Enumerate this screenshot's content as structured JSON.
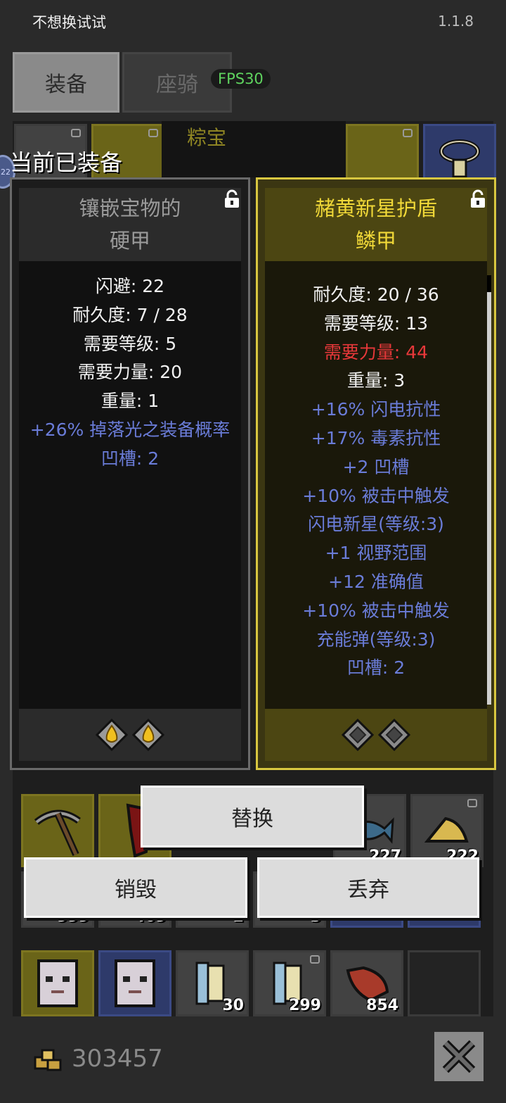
{
  "status": {
    "title": "不想换试试",
    "version": "1.1.8"
  },
  "tabs": {
    "equipment": "装备",
    "mount": "座骑"
  },
  "fps": "FPS30",
  "equipped_label": "当前已装备",
  "level_badge": "22",
  "top_item_label": "粽宝",
  "left_item": {
    "name_line1": "镶嵌宝物的",
    "name_line2": "硬甲",
    "stats": [
      {
        "text": "闪避: 22",
        "color": "white"
      },
      {
        "text": "耐久度: 7 / 28",
        "color": "white"
      },
      {
        "text": "需要等级: 5",
        "color": "white"
      },
      {
        "text": "需要力量: 20",
        "color": "white"
      },
      {
        "text": "重量: 1",
        "color": "white"
      },
      {
        "text": "+26% 掉落光之装备概率",
        "color": "blue"
      },
      {
        "text": "凹槽: 2",
        "color": "blue"
      }
    ],
    "sockets": [
      "gold-gem",
      "gold-gem"
    ]
  },
  "right_item": {
    "name_line1": "赭黄新星护盾",
    "name_line2": "鳞甲",
    "stats": [
      {
        "text": "耐久度: 20 / 36",
        "color": "white"
      },
      {
        "text": "需要等级: 13",
        "color": "white"
      },
      {
        "text": "需要力量: 44",
        "color": "red"
      },
      {
        "text": "重量: 3",
        "color": "white"
      },
      {
        "text": "+16% 闪电抗性",
        "color": "blue"
      },
      {
        "text": "+17% 毒素抗性",
        "color": "blue"
      },
      {
        "text": "+2 凹槽",
        "color": "blue"
      },
      {
        "text": "+10% 被击中触发",
        "color": "blue"
      },
      {
        "text": "闪电新星(等级:3)",
        "color": "blue"
      },
      {
        "text": "+1 视野范围",
        "color": "blue"
      },
      {
        "text": "+12 准确值",
        "color": "blue"
      },
      {
        "text": "+10% 被击中触发",
        "color": "blue"
      },
      {
        "text": "充能弹(等级:3)",
        "color": "blue"
      },
      {
        "text": "凹槽: 2",
        "color": "blue"
      }
    ],
    "sockets": [
      "empty-socket",
      "empty-socket"
    ]
  },
  "actions": {
    "replace": "替换",
    "destroy": "销毁",
    "discard": "丢弃"
  },
  "inventory_counts": {
    "row2": [
      "227",
      "222"
    ],
    "row3": [
      "999",
      "409",
      "2",
      "3"
    ],
    "row4": [
      "30",
      "299",
      "854"
    ]
  },
  "gold": "303457",
  "colors": {
    "white": "#f2f2f2",
    "blue": "#6a7cd8",
    "red": "#e8383a",
    "gold_border": "#d8c740"
  }
}
